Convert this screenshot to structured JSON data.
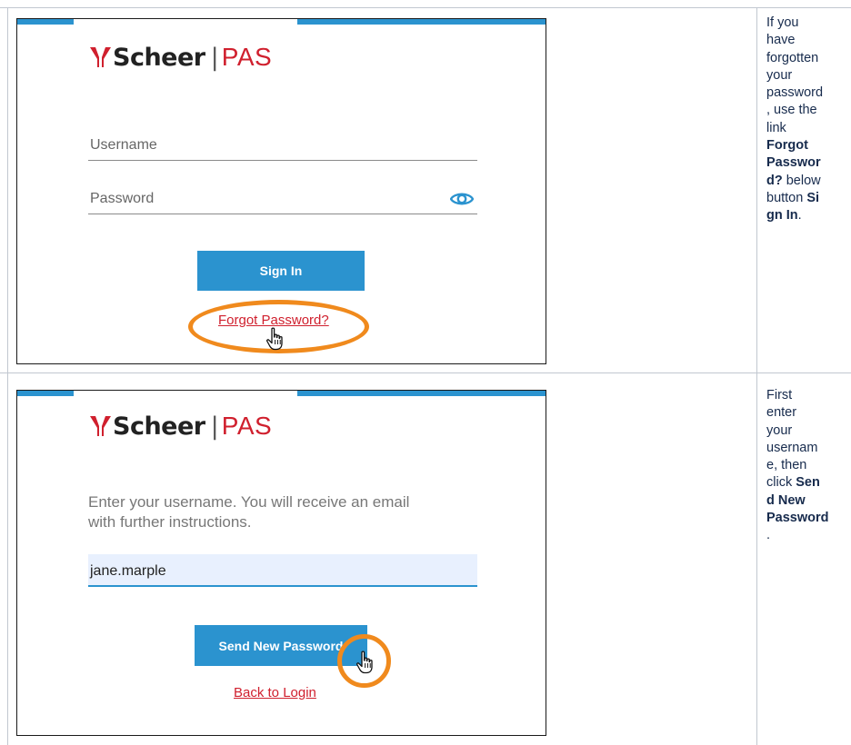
{
  "rows": [
    {
      "logo": {
        "brand": "Scheer",
        "separator": "|",
        "product": "PAS"
      },
      "username_placeholder": "Username",
      "password_placeholder": "Password",
      "sign_in_label": "Sign In",
      "forgot_label": "Forgot Password?",
      "desc_lines": [
        {
          "text": "If you"
        },
        {
          "text": "have"
        },
        {
          "text": "forgotten"
        },
        {
          "text": "your"
        },
        {
          "text": "password"
        },
        {
          "text": ", use the"
        },
        {
          "text": "link"
        },
        {
          "bold": "Forgot"
        },
        {
          "bold": "Passwor"
        },
        {
          "bold": "d?",
          "text": " below"
        },
        {
          "text": "button ",
          "bold": "Si"
        },
        {
          "bold": "gn In",
          "tail": "."
        }
      ]
    },
    {
      "logo": {
        "brand": "Scheer",
        "separator": "|",
        "product": "PAS"
      },
      "instructions_line1": "Enter your username. You will receive an email",
      "instructions_line2": "with further instructions.",
      "username_value": "jane.marple",
      "send_label": "Send New Password",
      "back_label": "Back to Login",
      "desc_lines": [
        {
          "text": "First"
        },
        {
          "text": "enter"
        },
        {
          "text": "your"
        },
        {
          "text": "usernam"
        },
        {
          "text": "e, then"
        },
        {
          "text": "click ",
          "bold": "Sen"
        },
        {
          "bold": "d New"
        },
        {
          "bold": "Password"
        },
        {
          "text": "."
        }
      ]
    }
  ],
  "colors": {
    "accent_blue": "#2b93cf",
    "brand_red": "#d0202e",
    "highlight_orange": "#f08a1d",
    "grid": "#c1c7d0"
  }
}
